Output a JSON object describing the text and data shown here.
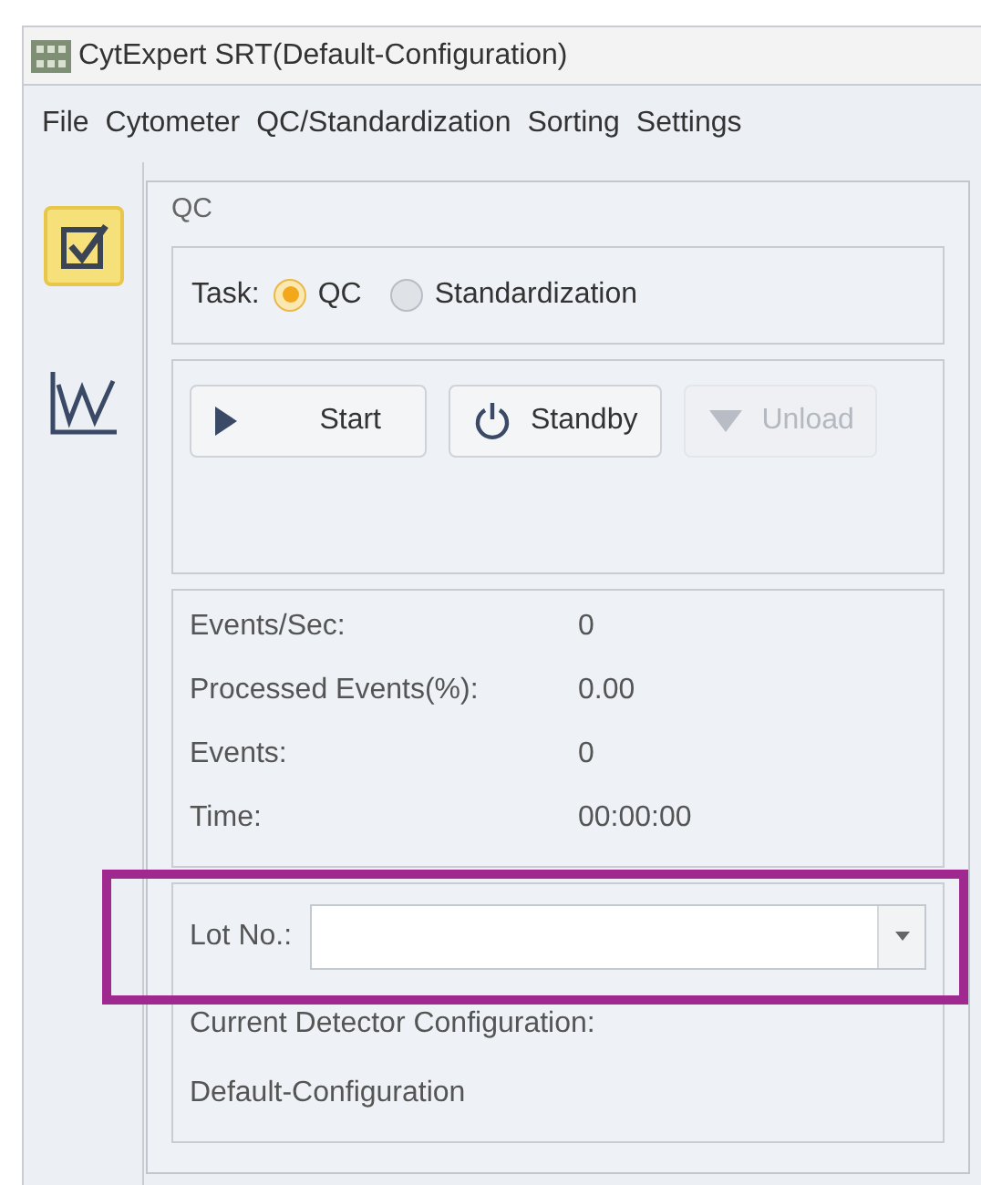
{
  "window": {
    "title": "CytExpert SRT(Default-Configuration)"
  },
  "menu": [
    "File",
    "Cytometer",
    "QC/Standardization",
    "Sorting",
    "Settings"
  ],
  "sidebar": {
    "items": [
      {
        "kind": "checklist",
        "selected": true
      },
      {
        "kind": "chart",
        "selected": false
      }
    ]
  },
  "panel": {
    "title": "QC",
    "task": {
      "label": "Task:",
      "options": [
        {
          "label": "QC",
          "selected": true
        },
        {
          "label": "Standardization",
          "selected": false
        }
      ]
    },
    "buttons": [
      {
        "kind": "start",
        "label": "Start",
        "disabled": false
      },
      {
        "kind": "standby",
        "label": "Standby",
        "disabled": false
      },
      {
        "kind": "unload",
        "label": "Unload",
        "disabled": true
      }
    ],
    "stats": [
      {
        "label": "Events/Sec:",
        "value": "0"
      },
      {
        "label": "Processed Events(%):",
        "value": "0.00"
      },
      {
        "label": "Events:",
        "value": "0"
      },
      {
        "label": "Time:",
        "value": "00:00:00"
      }
    ],
    "lot_field": {
      "label": "Lot No.:",
      "highlighted": true
    },
    "configuration": {
      "label": "Current Detector Configuration:",
      "value": "Default-Configuration"
    }
  }
}
